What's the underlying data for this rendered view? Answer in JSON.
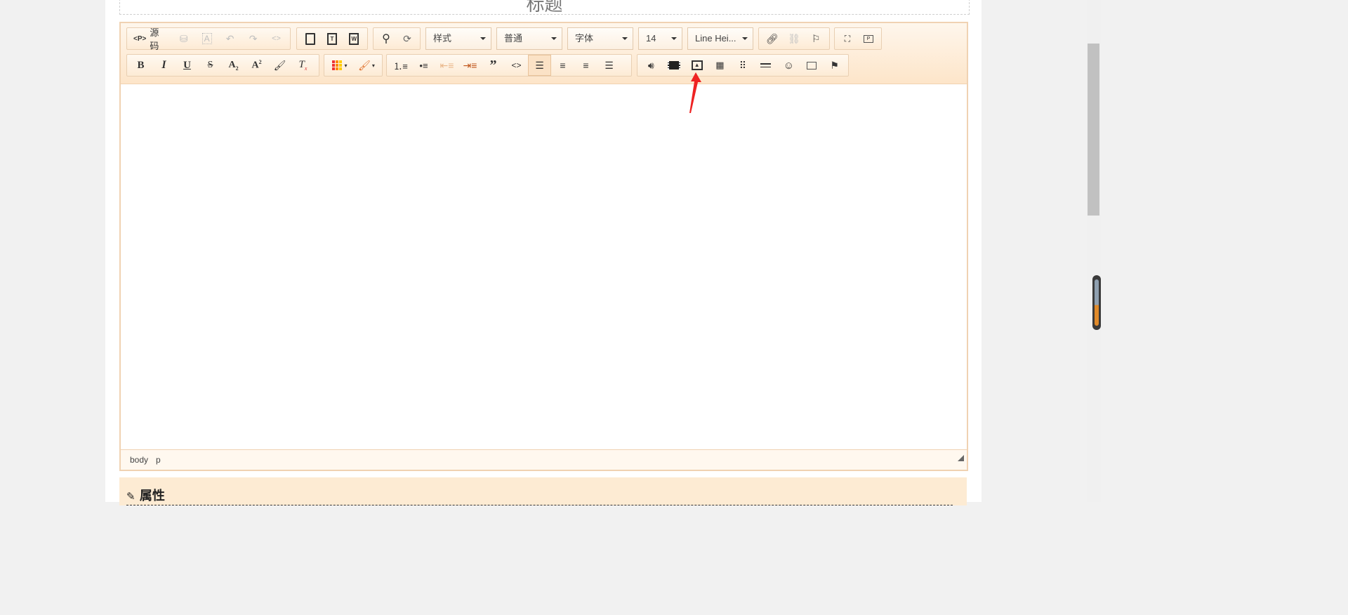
{
  "title_field": {
    "text": "标题"
  },
  "toolbar": {
    "source_label": "源码",
    "combos": {
      "style": "样式",
      "format": "普通",
      "font": "字体",
      "size": "14",
      "line_height": "Line Hei..."
    },
    "icons_row1": [
      "source-icon",
      "find-binoculars-icon",
      "select-all-icon",
      "undo-icon",
      "redo-icon",
      "code-brackets-icon",
      "paste-icon",
      "paste-text-icon",
      "paste-word-icon",
      "search-icon",
      "replace-icon",
      "link-icon",
      "unlink-icon",
      "anchor-flag-icon",
      "maximize-icon",
      "preview-icon"
    ],
    "icons_row2": [
      "bold-icon",
      "italic-icon",
      "underline-icon",
      "strikethrough-icon",
      "subscript-icon",
      "superscript-icon",
      "format-painter-icon",
      "clear-format-icon",
      "text-color-icon",
      "bg-color-icon",
      "numbered-list-icon",
      "bullet-list-icon",
      "outdent-icon",
      "indent-icon",
      "blockquote-icon",
      "code-icon",
      "align-left-icon",
      "align-center-icon",
      "align-right-icon",
      "justify-icon",
      "audio-icon",
      "video-icon",
      "image-icon",
      "image-gallery-icon",
      "table-icon",
      "horizontal-rule-icon",
      "emoji-icon",
      "iframe-icon",
      "flag-icon"
    ]
  },
  "statusbar": {
    "path": [
      "body",
      "p"
    ]
  },
  "properties": {
    "title": "属性"
  },
  "colors": {
    "accent": "#fde5c9",
    "border": "#f0d2b2",
    "annotation_arrow": "#ee2222",
    "gauge_orange": "#e08a2a"
  }
}
